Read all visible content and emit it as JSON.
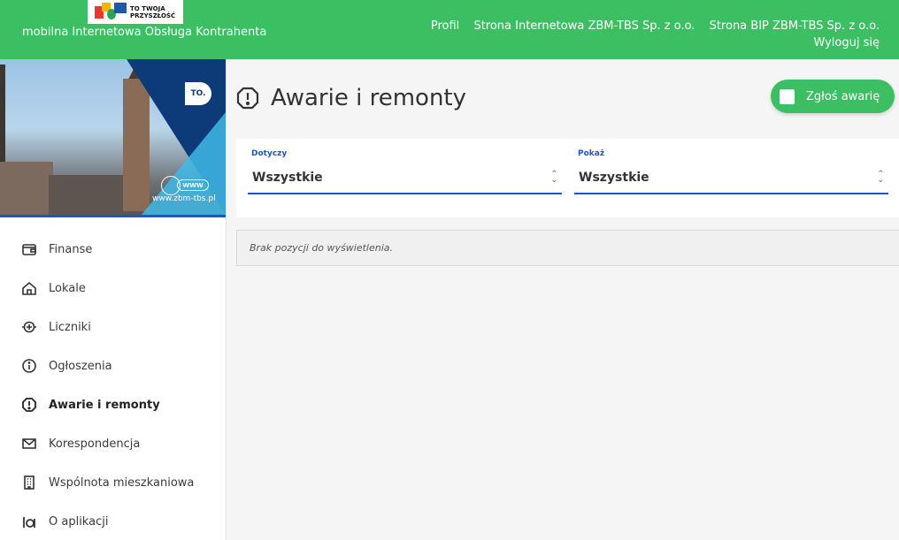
{
  "header": {
    "logo_text_line1": "TO TWOJA",
    "logo_text_line2": "PRZYSZŁOŚĆ",
    "app_title": "mobilna Internetowa Obsługa Kontrahenta",
    "nav": {
      "profile": "Profil",
      "website": "Strona Internetowa ZBM-TBS Sp. z o.o.",
      "bip": "Strona BIP ZBM-TBS Sp. z o.o.",
      "logout": "Wyloguj się"
    },
    "brand_color": "#3cbf63"
  },
  "banner": {
    "badge": "TO.",
    "www_label": "WWW",
    "url": "www.zbm-tbs.pl"
  },
  "sidebar": {
    "items": [
      {
        "label": "Finanse",
        "icon": "wallet-icon"
      },
      {
        "label": "Lokale",
        "icon": "home-icon"
      },
      {
        "label": "Liczniki",
        "icon": "meter-icon"
      },
      {
        "label": "Ogłoszenia",
        "icon": "info-icon"
      },
      {
        "label": "Awarie i remonty",
        "icon": "alert-icon",
        "active": true
      },
      {
        "label": "Korespondencja",
        "icon": "envelope-icon"
      },
      {
        "label": "Wspólnota mieszkaniowa",
        "icon": "building-icon"
      },
      {
        "label": "O aplikacji",
        "icon": "about-icon"
      }
    ]
  },
  "main": {
    "title": "Awarie i remonty",
    "report_button": "Zgłoś awarię",
    "filters": {
      "concerns": {
        "label": "Dotyczy",
        "value": "Wszystkie"
      },
      "show": {
        "label": "Pokaż",
        "value": "Wszystkie"
      }
    },
    "empty_message": "Brak pozycji do wyświetlenia."
  },
  "colors": {
    "accent_blue": "#1a56c9",
    "navy": "#0d3b79"
  }
}
